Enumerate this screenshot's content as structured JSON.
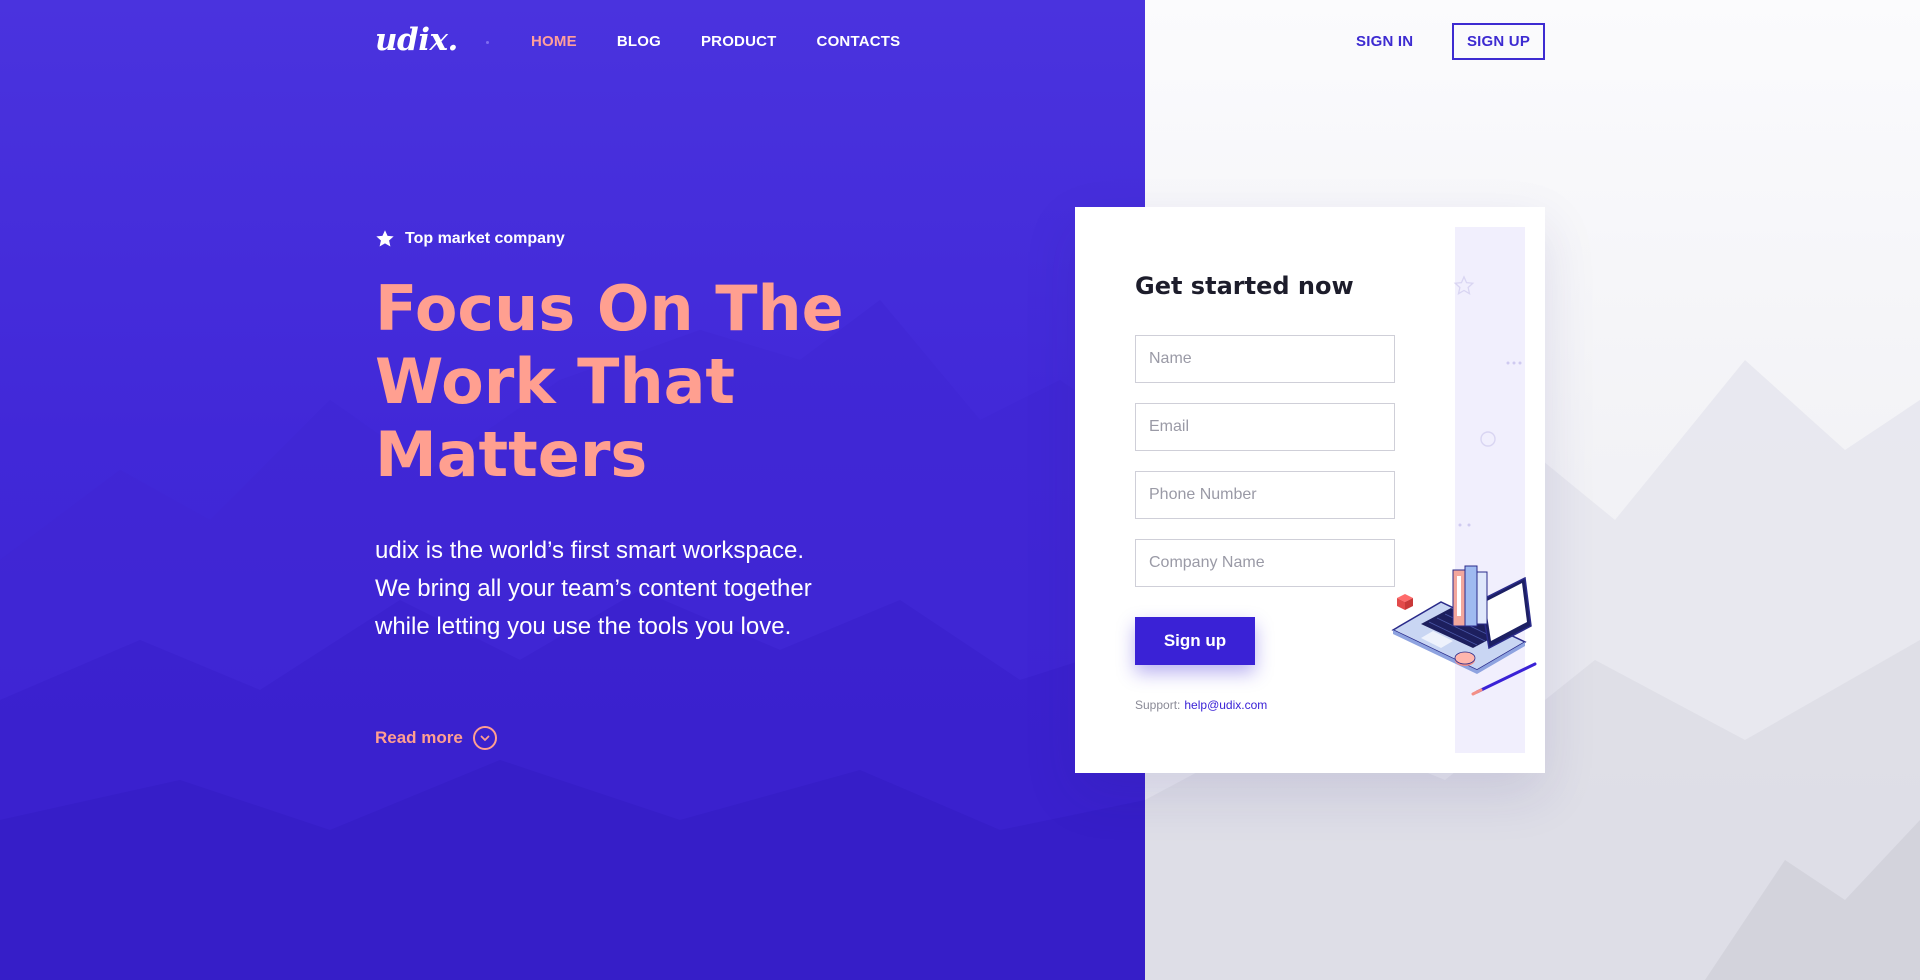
{
  "brand": {
    "logo": "udix."
  },
  "nav": {
    "items": [
      {
        "label": "HOME",
        "active": true
      },
      {
        "label": "BLOG",
        "active": false
      },
      {
        "label": "PRODUCT",
        "active": false
      },
      {
        "label": "CONTACTS",
        "active": false
      }
    ]
  },
  "auth": {
    "signin_label": "SIGN IN",
    "signup_label": "SIGN UP"
  },
  "hero": {
    "badge_icon": "star-icon",
    "badge_text": "Top market company",
    "headline_lines": [
      "Focus On The",
      "Work That",
      "Matters"
    ],
    "description_lines": [
      "udix is the world’s first smart workspace.",
      "We bring all your team’s content together",
      "while letting you use the tools you love."
    ],
    "read_more_label": "Read more",
    "read_more_icon": "chevron-down-circle-icon"
  },
  "form": {
    "title": "Get started now",
    "fields": {
      "name": {
        "placeholder": "Name",
        "value": ""
      },
      "email": {
        "placeholder": "Email",
        "value": ""
      },
      "phone": {
        "placeholder": "Phone Number",
        "value": ""
      },
      "company": {
        "placeholder": "Company Name",
        "value": ""
      }
    },
    "submit_label": "Sign up",
    "support_label": "Support:",
    "support_email": "help@udix.com",
    "illustration_icon": "laptop-books-illustration"
  },
  "colors": {
    "primary": "#3a22d6",
    "accent": "#ff9f90",
    "hero_bg": "#4330da",
    "text_dark": "#1d1d2b"
  }
}
